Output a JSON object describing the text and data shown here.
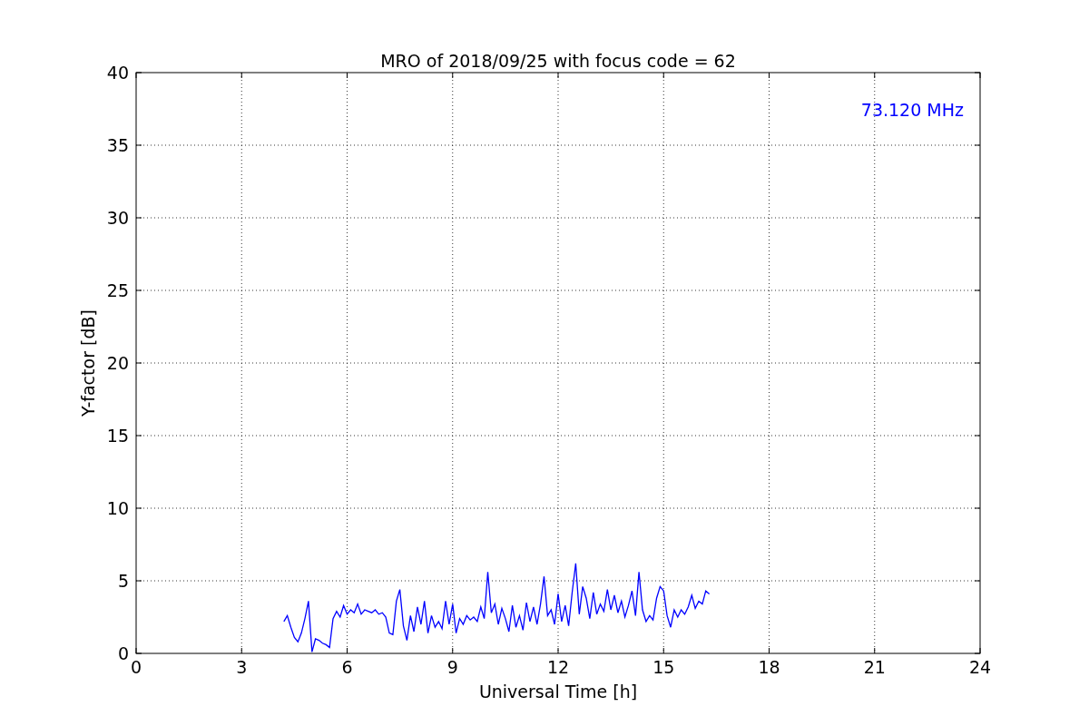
{
  "chart_data": {
    "type": "line",
    "title": "MRO of 2018/09/25 with focus code = 62",
    "xlabel": "Universal Time [h]",
    "ylabel": "Y-factor [dB]",
    "x": [
      4.2,
      4.3,
      4.4,
      4.5,
      4.6,
      4.7,
      4.8,
      4.9,
      5.0,
      5.1,
      5.2,
      5.3,
      5.4,
      5.5,
      5.6,
      5.7,
      5.8,
      5.9,
      6.0,
      6.1,
      6.2,
      6.3,
      6.4,
      6.5,
      6.6,
      6.7,
      6.8,
      6.9,
      7.0,
      7.1,
      7.2,
      7.3,
      7.4,
      7.5,
      7.6,
      7.7,
      7.8,
      7.9,
      8.0,
      8.1,
      8.2,
      8.3,
      8.4,
      8.5,
      8.6,
      8.7,
      8.8,
      8.9,
      9.0,
      9.1,
      9.2,
      9.3,
      9.4,
      9.5,
      9.6,
      9.7,
      9.8,
      9.9,
      10.0,
      10.1,
      10.2,
      10.3,
      10.4,
      10.5,
      10.6,
      10.7,
      10.8,
      10.9,
      11.0,
      11.1,
      11.2,
      11.3,
      11.4,
      11.5,
      11.6,
      11.7,
      11.8,
      11.9,
      12.0,
      12.1,
      12.2,
      12.3,
      12.4,
      12.5,
      12.6,
      12.7,
      12.8,
      12.9,
      13.0,
      13.1,
      13.2,
      13.3,
      13.4,
      13.5,
      13.6,
      13.7,
      13.8,
      13.9,
      14.0,
      14.1,
      14.2,
      14.3,
      14.4,
      14.5,
      14.6,
      14.7,
      14.8,
      14.9,
      15.0,
      15.1,
      15.2,
      15.3,
      15.4,
      15.5,
      15.6,
      15.7,
      15.8,
      15.9,
      16.0,
      16.1,
      16.2,
      16.3
    ],
    "series": [
      {
        "name": "73.120 MHz",
        "color": "#0000ff",
        "values": [
          2.2,
          2.6,
          1.8,
          1.1,
          0.8,
          1.4,
          2.4,
          3.6,
          0.1,
          1.0,
          0.9,
          0.7,
          0.6,
          0.4,
          2.4,
          2.9,
          2.5,
          3.3,
          2.7,
          3.0,
          2.8,
          3.4,
          2.7,
          3.0,
          2.9,
          2.8,
          3.0,
          2.7,
          2.8,
          2.5,
          1.4,
          1.3,
          3.6,
          4.4,
          1.9,
          0.9,
          2.6,
          1.5,
          3.2,
          2.0,
          3.6,
          1.4,
          2.6,
          1.8,
          2.2,
          1.7,
          3.6,
          2.0,
          3.4,
          1.4,
          2.4,
          2.0,
          2.6,
          2.3,
          2.5,
          2.2,
          3.2,
          2.4,
          5.6,
          2.8,
          3.4,
          2.0,
          3.1,
          2.4,
          1.5,
          3.3,
          1.8,
          2.6,
          1.6,
          3.5,
          2.2,
          3.2,
          2.0,
          3.4,
          5.3,
          2.6,
          3.0,
          2.0,
          4.1,
          2.2,
          3.3,
          1.9,
          4.2,
          6.2,
          2.7,
          4.6,
          3.8,
          2.4,
          4.2,
          2.7,
          3.4,
          2.9,
          4.4,
          3.0,
          4.0,
          2.8,
          3.6,
          2.5,
          3.3,
          4.3,
          2.6,
          5.6,
          3.0,
          2.2,
          2.6,
          2.3,
          3.8,
          4.6,
          4.3,
          2.6,
          1.8,
          3.0,
          2.5,
          3.0,
          2.7,
          3.2,
          4.0,
          3.1,
          3.6,
          3.4,
          4.3,
          4.1
        ]
      }
    ],
    "xlim": [
      0,
      24
    ],
    "ylim": [
      0,
      40
    ],
    "xticks": [
      0,
      3,
      6,
      9,
      12,
      15,
      18,
      21,
      24
    ],
    "yticks": [
      0,
      5,
      10,
      15,
      20,
      25,
      30,
      35,
      40
    ],
    "grid": true
  }
}
